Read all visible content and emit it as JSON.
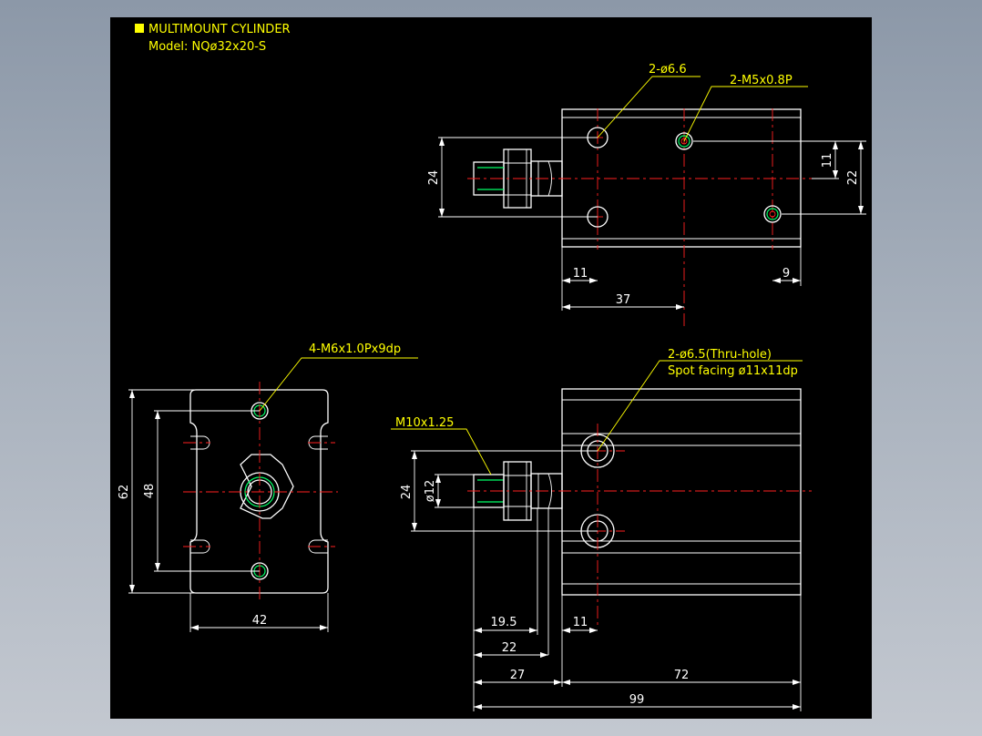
{
  "title_block": {
    "title": "MULTIMOUNT CYLINDER",
    "model": "Model: NQø32x20-S",
    "marker_color": "#ffff00"
  },
  "colors": {
    "background_sheet": "#000000",
    "outline": "#ffffff",
    "leader": "#ffff00",
    "center_line": "#ff2020",
    "thread": "#00ff66"
  },
  "top_view": {
    "callout_holes": "2-ø6.6",
    "callout_tapped": "2-M5x0.8P",
    "dims": {
      "height_rod": "24",
      "tapped_offset": "11",
      "tapped_span": "22",
      "hole_from_left": "11",
      "tapped_from_right": "9",
      "left_to_tapped": "37"
    }
  },
  "front_view": {
    "callout_tapped": "4-M6x1.0Px9dp",
    "dims": {
      "height_total": "62",
      "hole_span": "48",
      "width": "42"
    }
  },
  "side_view": {
    "callout_thru_1": "2-ø6.5(Thru-hole)",
    "callout_thru_2": "Spot facing ø11x11dp",
    "callout_thread": "M10x1.25",
    "dims": {
      "rod_span": "24",
      "rod_dia": "ø12",
      "rod_19_5": "19.5",
      "hole_from_left": "11",
      "rod_22": "22",
      "rod_27": "27",
      "body_72": "72",
      "total_99": "99"
    }
  }
}
